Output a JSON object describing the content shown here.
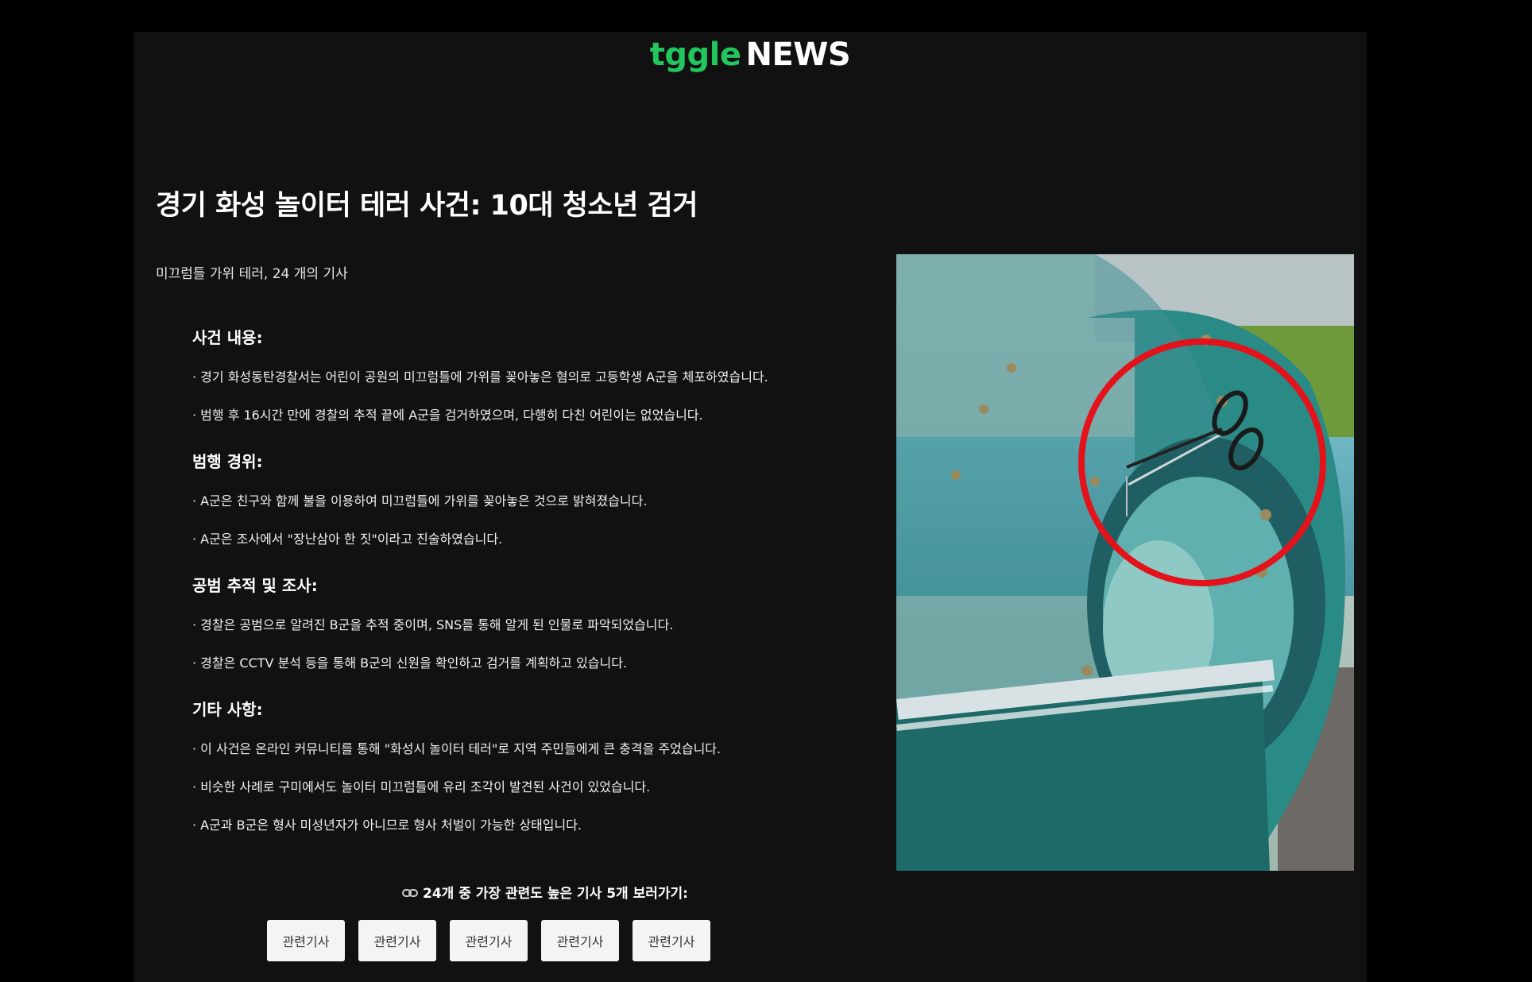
{
  "brand": {
    "part1": "tggle",
    "part2": "NEWS"
  },
  "article": {
    "title": "경기 화성 놀이터 테러 사건: 10대 청소년 검거",
    "subinfo": "미끄럼틀 가위 테러, 24 개의 기사",
    "sections": [
      {
        "heading": "사건 내용:",
        "bullets": [
          "· 경기 화성동탄경찰서는 어린이 공원의 미끄럼틀에 가위를 꽂아놓은 혐의로 고등학생 A군을 체포하였습니다.",
          "· 범행 후 16시간 만에 경찰의 추적 끝에 A군을 검거하였으며, 다행히 다친 어린이는 없었습니다."
        ]
      },
      {
        "heading": "범행 경위:",
        "bullets": [
          "· A군은 친구와 함께 불을 이용하여 미끄럼틀에 가위를 꽂아놓은 것으로 밝혀졌습니다.",
          "· A군은 조사에서 \"장난삼아 한 짓\"이라고 진술하였습니다."
        ]
      },
      {
        "heading": "공범 추적 및 조사:",
        "bullets": [
          "· 경찰은 공범으로 알려진 B군을 추적 중이며, SNS를 통해 알게 된 인물로 파악되었습니다.",
          "· 경찰은 CCTV 분석 등을 통해 B군의 신원을 확인하고 검거를 계획하고 있습니다."
        ]
      },
      {
        "heading": "기타 사항:",
        "bullets": [
          "· 이 사건은 온라인 커뮤니티를 통해 \"화성시 놀이터 테러\"로 지역 주민들에게 큰 충격을 주었습니다.",
          "· 비슷한 사례로 구미에서도 놀이터 미끄럼틀에 유리 조각이 발견된 사건이 있었습니다.",
          "· A군과 B군은 형사 미성년자가 아니므로 형사 처벌이 가능한 상태입니다."
        ]
      }
    ]
  },
  "related": {
    "label": "24개 중 가장 관련도 높은 기사 5개 보러가기:",
    "buttons": [
      "관련기사",
      "관련기사",
      "관련기사",
      "관련기사",
      "관련기사"
    ]
  },
  "icons": {
    "link": "link-icon"
  },
  "colors": {
    "brand_green": "#22c55e",
    "panel_bg": "#111111",
    "highlight_circle": "#e3121b"
  }
}
